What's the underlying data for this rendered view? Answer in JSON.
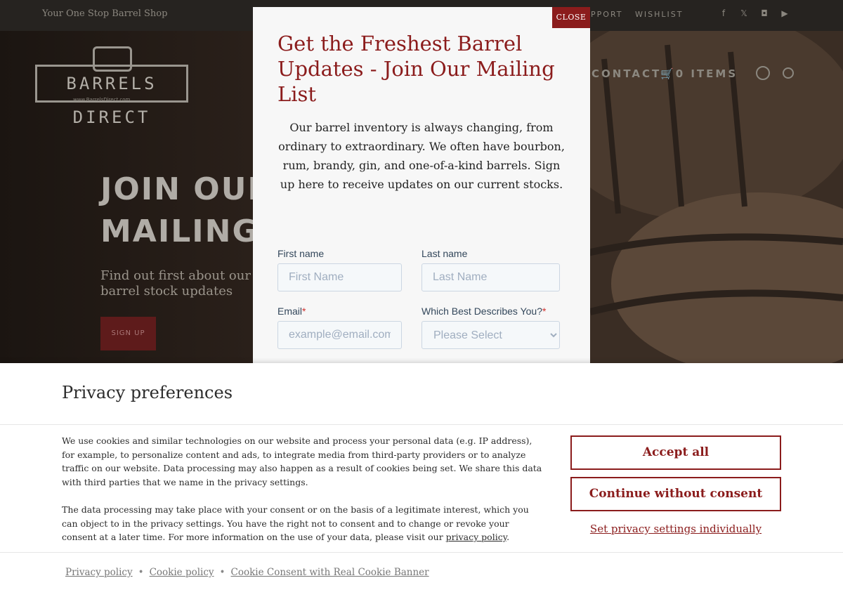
{
  "site": {
    "tagline": "Your One Stop Barrel Shop",
    "top_nav": [
      "SUPPORT",
      "WISHLIST"
    ],
    "social_icons": [
      "facebook-icon",
      "x-icon",
      "instagram-icon",
      "youtube-icon"
    ],
    "logo_text": "BARRELS DIRECT",
    "logo_sub": "www.BarrelsDirect.com",
    "main_nav": [
      "CONTACT",
      "0 ITEMS"
    ],
    "hero_title_line1": "JOIN OUR",
    "hero_title_line2": "MAILING L",
    "hero_sub_line1": "Find out first about our f",
    "hero_sub_line2": "barrel stock updates",
    "hero_button": "SIGN UP"
  },
  "modal": {
    "close_label": "CLOSE",
    "title": "Get the Freshest Barrel Updates - Join Our Mailing List",
    "body": "Our barrel inventory is always changing, from ordinary to extraordinary. We often have bourbon, rum, brandy, gin, and one-of-a-kind barrels. Sign up here to receive updates on our current stocks.",
    "form": {
      "first_name_label": "First name",
      "first_name_placeholder": "First Name",
      "last_name_label": "Last name",
      "last_name_placeholder": "Last Name",
      "email_label": "Email",
      "email_placeholder": "example@email.com",
      "describes_label": "Which Best Describes You?",
      "describes_selected": "Please Select",
      "required_mark": "*"
    }
  },
  "privacy": {
    "title": "Privacy preferences",
    "paragraph1": "We use cookies and similar technologies on our website and process your personal data (e.g. IP address), for example, to personalize content and ads, to integrate media from third-party providers or to analyze traffic on our website. Data processing may also happen as a result of cookies being set. We share this data with third parties that we name in the privacy settings.",
    "paragraph2_pre": "The data processing may take place with your consent or on the basis of a legitimate interest, which you can object to in the privacy settings. You have the right not to consent and to change or revoke your consent at a later time. For more information on the use of your data, please visit our ",
    "paragraph2_link": "privacy policy",
    "paragraph2_post": ".",
    "accept_all": "Accept all",
    "continue_without": "Continue without consent",
    "set_individually": "Set privacy settings individually",
    "footer_links": [
      "Privacy policy",
      "Cookie policy",
      "Cookie Consent with Real Cookie Banner"
    ],
    "footer_separator": "•"
  },
  "colors": {
    "brand_red": "#8b1c1c",
    "background": "#ffffff"
  }
}
